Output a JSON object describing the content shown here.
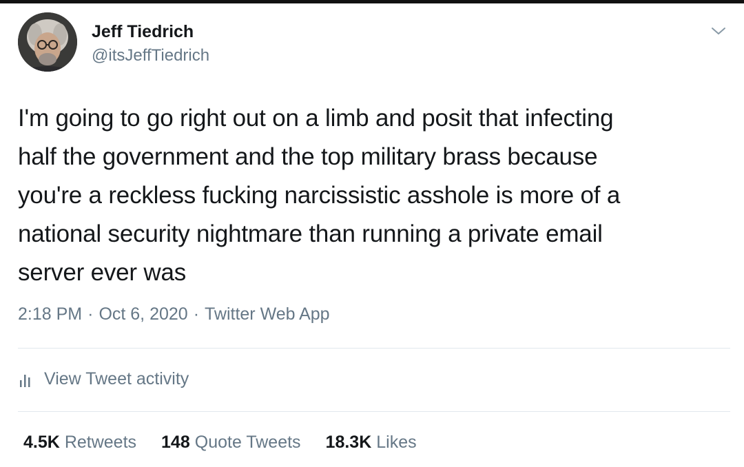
{
  "tweet": {
    "author": {
      "display_name": "Jeff Tiedrich",
      "handle": "@itsJeffTiedrich"
    },
    "text": "I'm going to go right out on a limb and posit that infecting\nhalf the government and the top military brass because\nyou're a reckless fucking narcissistic asshole is more of a\nnational security nightmare than running a private email\nserver ever was",
    "time": "2:18 PM",
    "date": "Oct 6, 2020",
    "separator": "·",
    "source": "Twitter Web App",
    "activity_label": "View Tweet activity",
    "stats": {
      "retweets_count": "4.5K",
      "retweets_label": "Retweets",
      "quotes_count": "148",
      "quotes_label": "Quote Tweets",
      "likes_count": "18.3K",
      "likes_label": "Likes"
    }
  },
  "icons": {
    "menu": "chevron-down-icon",
    "activity": "bar-chart-icon"
  },
  "colors": {
    "text_primary": "#14171a",
    "text_secondary": "#657786",
    "divider": "#e1e8ed"
  }
}
